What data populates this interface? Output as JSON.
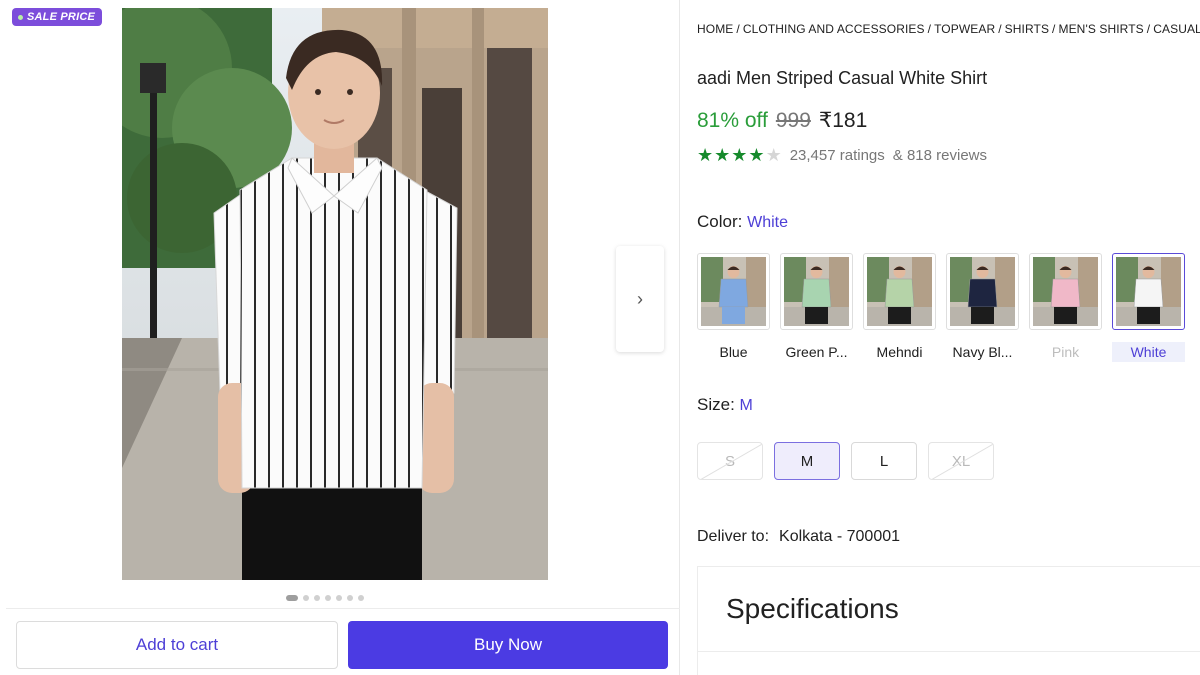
{
  "badge": {
    "label": "SALE PRICE"
  },
  "gallery": {
    "next_icon": "chevron-right-icon",
    "next_glyph": "›",
    "dots_total": 7,
    "dots_active": 0
  },
  "actions": {
    "add_to_cart": "Add to cart",
    "buy_now": "Buy Now"
  },
  "breadcrumb": [
    "HOME",
    "CLOTHING AND ACCESSORIES",
    "TOPWEAR",
    "SHIRTS",
    "MEN'S SHIRTS",
    "CASUAL"
  ],
  "breadcrumb_sep": "/",
  "product": {
    "title": "aadi Men Striped Casual White Shirt",
    "discount": "81% off",
    "mrp": "999",
    "price": "₹181",
    "rating_stars": 4,
    "rating_max": 5,
    "ratings": "23,457 ratings",
    "reviews": "& 818 reviews"
  },
  "color": {
    "label": "Color:",
    "selected": "White",
    "options": [
      {
        "label": "Blue",
        "state": "normal",
        "shirt": "#7fa8e0"
      },
      {
        "label": "Green P...",
        "state": "normal",
        "shirt": "#a8d4b0"
      },
      {
        "label": "Mehndi",
        "state": "normal",
        "shirt": "#b5d3a8"
      },
      {
        "label": "Navy Bl...",
        "state": "normal",
        "shirt": "#1e2540"
      },
      {
        "label": "Pink",
        "state": "disabled",
        "shirt": "#f0b8c8"
      },
      {
        "label": "White",
        "state": "selected",
        "shirt": "#f5f5f5"
      }
    ]
  },
  "size": {
    "label": "Size:",
    "selected": "M",
    "options": [
      {
        "label": "S",
        "state": "disabled"
      },
      {
        "label": "M",
        "state": "selected"
      },
      {
        "label": "L",
        "state": "normal"
      },
      {
        "label": "XL",
        "state": "disabled"
      }
    ]
  },
  "delivery": {
    "label": "Deliver to:",
    "location": "Kolkata - 700001"
  },
  "specifications": {
    "title": "Specifications"
  },
  "colors": {
    "accent": "#4b3be3",
    "discount_green": "#2a9d3a",
    "rating_green": "#168a2c",
    "badge_purple": "#7c4ddb"
  }
}
